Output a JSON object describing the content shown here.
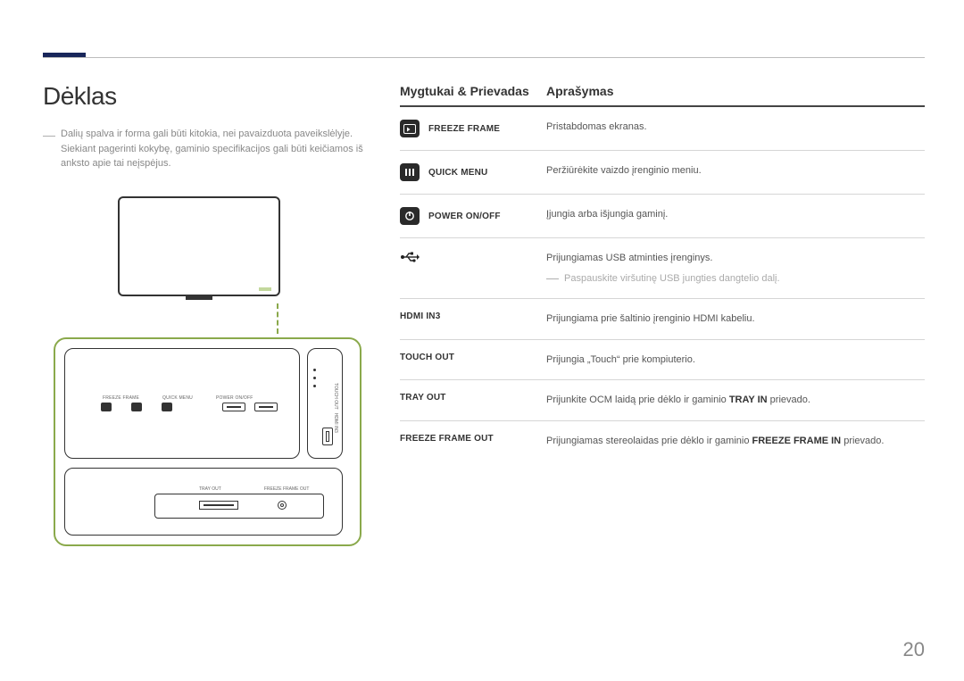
{
  "section_title": "Dėklas",
  "note_text": "Dalių spalva ir forma gali būti kitokia, nei pavaizduota paveikslėlyje. Siekiant pagerinti kokybę, gaminio specifikacijos gali būti keičiamos iš anksto apie tai neįspėjus.",
  "table_header": {
    "col1": "Mygtukai & Prievadas",
    "col2": "Aprašymas"
  },
  "rows": [
    {
      "label": "FREEZE FRAME",
      "desc": "Pristabdomas ekranas."
    },
    {
      "label": "QUICK MENU",
      "desc": "Peržiūrėkite vaizdo įrenginio meniu."
    },
    {
      "label": "POWER ON/OFF",
      "desc": "Įjungia arba išjungia gaminį."
    },
    {
      "label": "",
      "desc": "Prijungiamas USB atminties įrenginys.",
      "sub": "Paspauskite viršutinę USB jungties dangtelio dalį."
    },
    {
      "label": "HDMI IN3",
      "desc": "Prijungiama prie šaltinio įrenginio HDMI kabeliu."
    },
    {
      "label": "TOUCH OUT",
      "desc": "Prijungia „Touch“ prie kompiuterio."
    },
    {
      "label": "TRAY OUT",
      "desc_pre": "Prijunkite OCM laidą prie dėklo ir gaminio ",
      "desc_bold": "TRAY IN",
      "desc_post": " prievado."
    },
    {
      "label": "FREEZE FRAME OUT",
      "desc_pre": "Prijungiamas stereolaidas prie dėklo ir gaminio ",
      "desc_bold": "FREEZE FRAME IN",
      "desc_post": " prievado."
    }
  ],
  "diagram_labels": {
    "btn1": "FREEZE FRAME",
    "btn2": "QUICK MENU",
    "btn3": "POWER ON/OFF",
    "side1": "HDMI IN3",
    "side2": "TOUCH OUT",
    "bottom1": "TRAY OUT",
    "bottom2": "FREEZE FRAME OUT"
  },
  "page_number": "20"
}
